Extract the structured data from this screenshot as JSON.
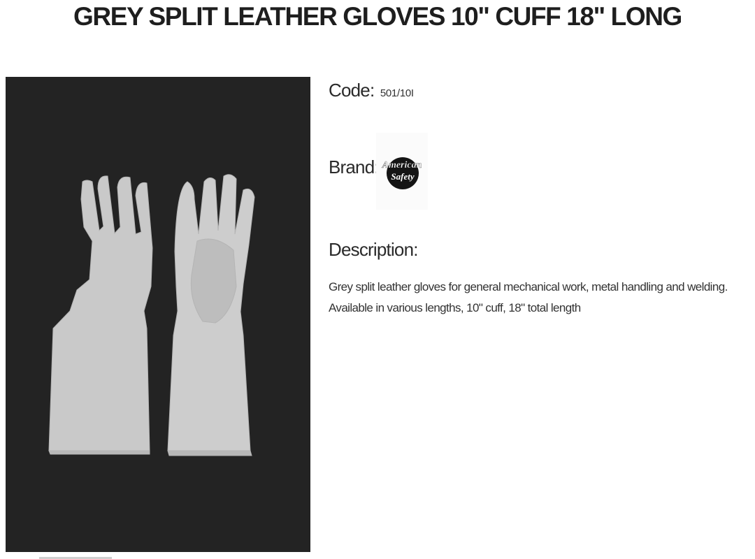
{
  "product": {
    "title": "GREY SPLIT LEATHER GLOVES 10\" CUFF 18\" LONG",
    "code_label": "Code:",
    "code_value": "501/10I",
    "brand_label": "Brand:",
    "brand_logo_text_line1": "American",
    "brand_logo_text_line2": "Safety",
    "description_label": "Description:",
    "description_text": "Grey split leather gloves for general mechanical work, metal handling and welding. Available in various lengths, 10\" cuff, 18\" total length"
  },
  "colors": {
    "photo_background": "#232323",
    "glove": "#cbcbcb",
    "text": "#222222"
  },
  "icons": {
    "brand_logo": "american-safety-logo",
    "product_image": "grey-leather-gloves-photo"
  }
}
